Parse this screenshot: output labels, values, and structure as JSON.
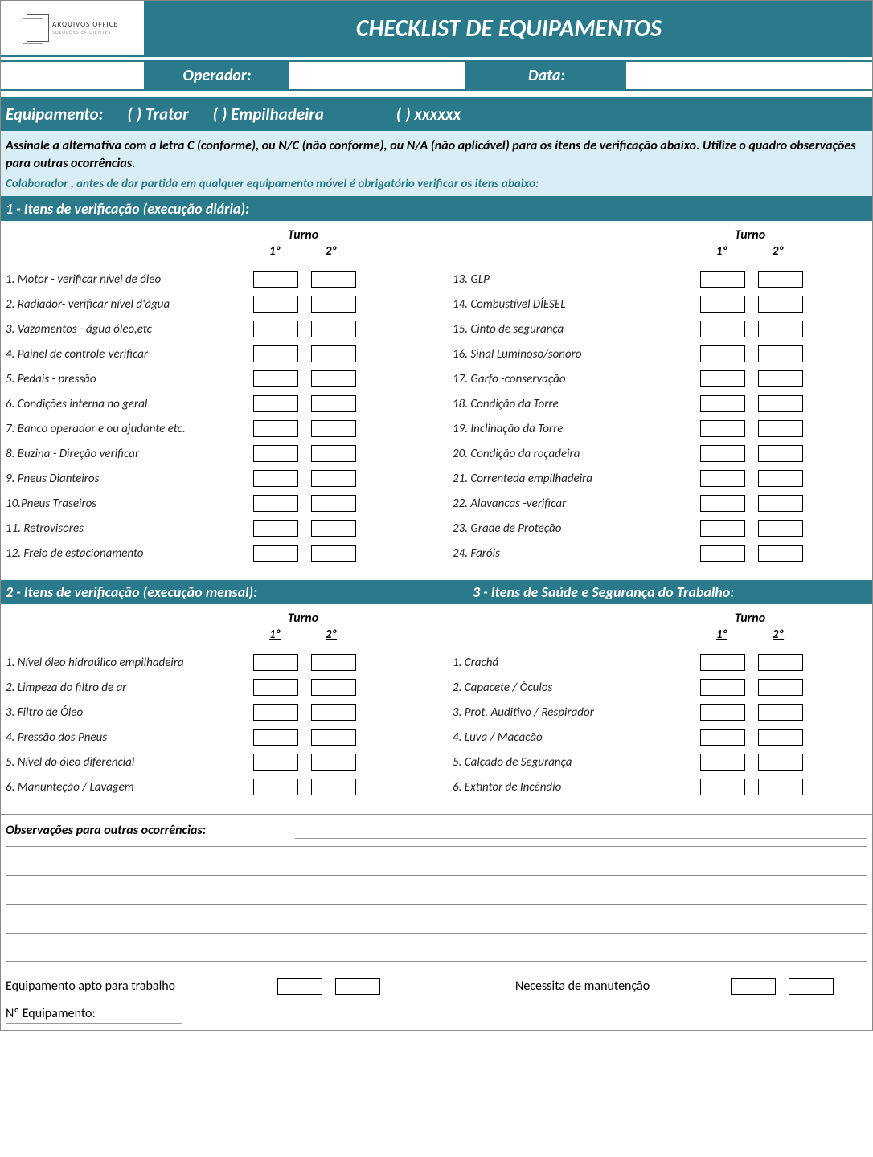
{
  "logo": {
    "brand": "ARQUIVOS OFFICE",
    "tagline": "SOLUÇÕES EFICIENTES"
  },
  "title": "CHECKLIST DE  EQUIPAMENTOS",
  "header": {
    "operador_label": "Operador:",
    "operador_value": "",
    "data_label": "Data:",
    "data_value": ""
  },
  "equip_row": {
    "label": "Equipamento:",
    "opt1": "(    )  Trator",
    "opt2": "(    )  Empilhadeira",
    "opt3": "(    ) xxxxxx"
  },
  "instructions": {
    "line1": "Assinale a alternativa com a letra C (conforme), ou  N/C (não conforme), ou  N/A (não aplicável) para os itens de verificação abaixo. Utilize o quadro observações para outras ocorrências.",
    "line2": "Colaborador , antes de dar partida em qualquer  equipamento móvel é obrigatório verificar  os itens abaixo:"
  },
  "section1": {
    "title": "1 - Itens de verificação (execução diária):",
    "turno": "Turno",
    "t1": "1º",
    "t2": "2º",
    "left": [
      "1. Motor - verificar nível de óleo",
      "2. Radiador- verificar nível d'água",
      "3. Vazamentos - água  óleo,etc",
      "4. Painel de controle-verificar",
      "5. Pedais - pressão",
      "6. Condições interna no geral",
      "7. Banco operador e ou ajudante etc.",
      "8. Buzina - Direção verificar",
      "9. Pneus Dianteiros",
      "10.Pneus Traseiros",
      "11. Retrovisores",
      "12. Freio de estacionamento"
    ],
    "right": [
      "13. GLP",
      "14. Combustível DÍESEL",
      "15. Cinto de segurança",
      "16. Sinal Luminoso/sonoro",
      "17. Garfo -conservação",
      "18. Condição da  Torre",
      "19. Inclinação da Torre",
      "20. Condição da roçadeira",
      "21. Correnteda empilhadeira",
      "22. Alavancas -verificar",
      "23. Grade de Proteção",
      "24. Faróis"
    ]
  },
  "section2": {
    "title_left": "2 - Itens de verificação (execução mensal):",
    "title_right": "3 - Itens de Saúde e Segurança do Trabalho:",
    "turno": "Turno",
    "t1": "1º",
    "t2": "2º",
    "left": [
      "1. Nível óleo hidraúlico empilhadeira",
      "2. Limpeza do filtro de ar",
      "3. Filtro de Óleo",
      "4. Pressão dos Pneus",
      "5. Nível do óleo diferencial",
      "6. Manunteção / Lavagem"
    ],
    "right": [
      "1. Crachá",
      "2. Capacete / Óculos",
      "3. Prot. Auditivo / Respirador",
      "4. Luva / Macacão",
      "5. Calçado  de Segurança",
      "6. Extintor de Incêndio"
    ]
  },
  "obs": {
    "title": "Observações para outras ocorrências:"
  },
  "footer": {
    "apto": "Equipamento apto para trabalho",
    "manut": "Necessita de manutenção",
    "neq": "Nº Equipamento:"
  }
}
